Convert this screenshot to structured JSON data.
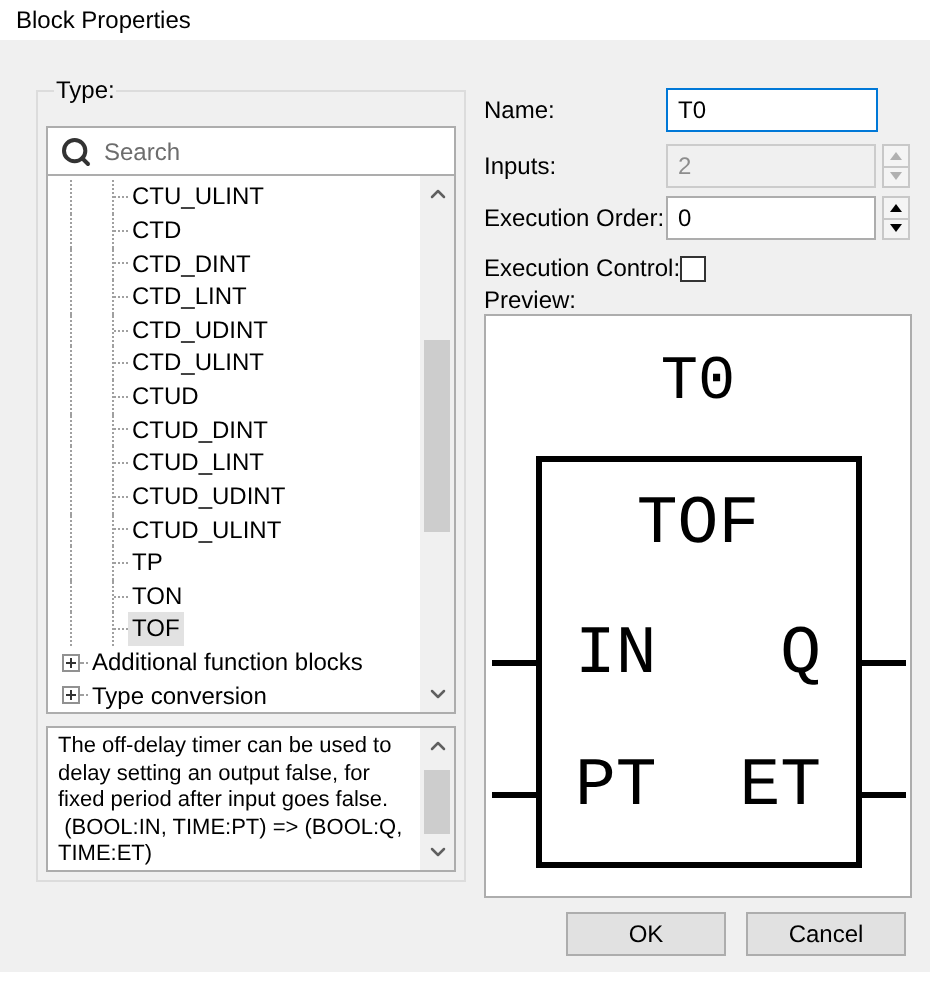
{
  "window": {
    "title": "Block Properties"
  },
  "type_group": {
    "label": "Type:",
    "search": {
      "placeholder": "Search"
    },
    "tree_items": [
      {
        "kind": "leaf",
        "label": "CTU_ULINT",
        "selected": false
      },
      {
        "kind": "leaf",
        "label": "CTD",
        "selected": false
      },
      {
        "kind": "leaf",
        "label": "CTD_DINT",
        "selected": false
      },
      {
        "kind": "leaf",
        "label": "CTD_LINT",
        "selected": false
      },
      {
        "kind": "leaf",
        "label": "CTD_UDINT",
        "selected": false
      },
      {
        "kind": "leaf",
        "label": "CTD_ULINT",
        "selected": false
      },
      {
        "kind": "leaf",
        "label": "CTUD",
        "selected": false
      },
      {
        "kind": "leaf",
        "label": "CTUD_DINT",
        "selected": false
      },
      {
        "kind": "leaf",
        "label": "CTUD_LINT",
        "selected": false
      },
      {
        "kind": "leaf",
        "label": "CTUD_UDINT",
        "selected": false
      },
      {
        "kind": "leaf",
        "label": "CTUD_ULINT",
        "selected": false
      },
      {
        "kind": "leaf",
        "label": "TP",
        "selected": false
      },
      {
        "kind": "leaf",
        "label": "TON",
        "selected": false
      },
      {
        "kind": "leaf",
        "label": "TOF",
        "selected": true
      },
      {
        "kind": "group",
        "label": "Additional function blocks",
        "expanded": false
      },
      {
        "kind": "group",
        "label": "Type conversion",
        "expanded": false
      }
    ],
    "description": "The off-delay timer can be used to delay setting an output false, for fixed period after input goes false.\n (BOOL:IN, TIME:PT) => (BOOL:Q, TIME:ET)"
  },
  "fields": [
    {
      "kind": "text",
      "label": "Name:",
      "value": "T0",
      "focused": true,
      "disabled": false
    },
    {
      "kind": "spin",
      "label": "Inputs:",
      "value": "2",
      "focused": false,
      "disabled": true
    },
    {
      "kind": "spin",
      "label": "Execution Order:",
      "value": "0",
      "focused": false,
      "disabled": false
    }
  ],
  "execution_control": {
    "label": "Execution Control:",
    "checked": false
  },
  "preview": {
    "label": "Preview:",
    "instance_name": "T0",
    "block_type": "TOF",
    "inputs": [
      "IN",
      "PT"
    ],
    "outputs": [
      "Q",
      "ET"
    ]
  },
  "buttons": [
    "OK",
    "Cancel"
  ]
}
